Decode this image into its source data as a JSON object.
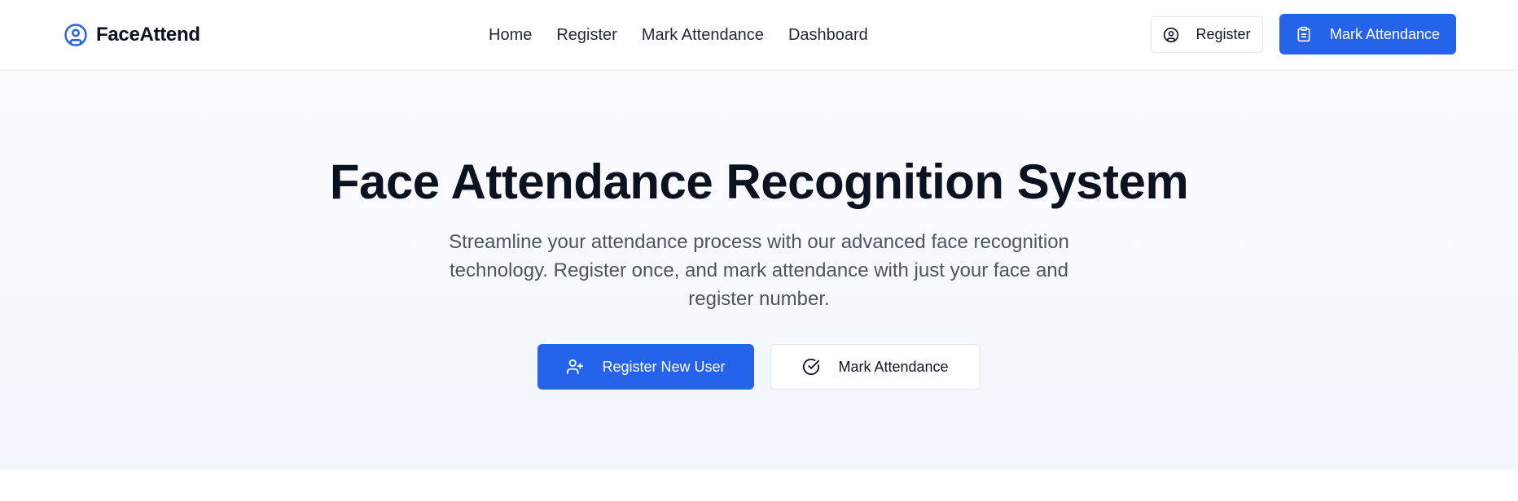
{
  "brand": {
    "name": "FaceAttend",
    "icon": "user-circle-icon"
  },
  "nav": {
    "items": [
      {
        "label": "Home"
      },
      {
        "label": "Register"
      },
      {
        "label": "Mark Attendance"
      },
      {
        "label": "Dashboard"
      }
    ]
  },
  "header_actions": {
    "register_label": "Register",
    "register_icon": "user-circle-icon",
    "mark_label": "Mark Attendance",
    "mark_icon": "clipboard-icon"
  },
  "hero": {
    "title": "Face Attendance Recognition System",
    "subtitle": "Streamline your attendance process with our advanced face recognition technology. Register once, and mark attendance with just your face and register number.",
    "primary_label": "Register New User",
    "primary_icon": "user-plus-icon",
    "secondary_label": "Mark Attendance",
    "secondary_icon": "check-circle-icon"
  },
  "colors": {
    "accent": "#2563eb",
    "text": "#0f172a",
    "muted": "#4b5563"
  }
}
